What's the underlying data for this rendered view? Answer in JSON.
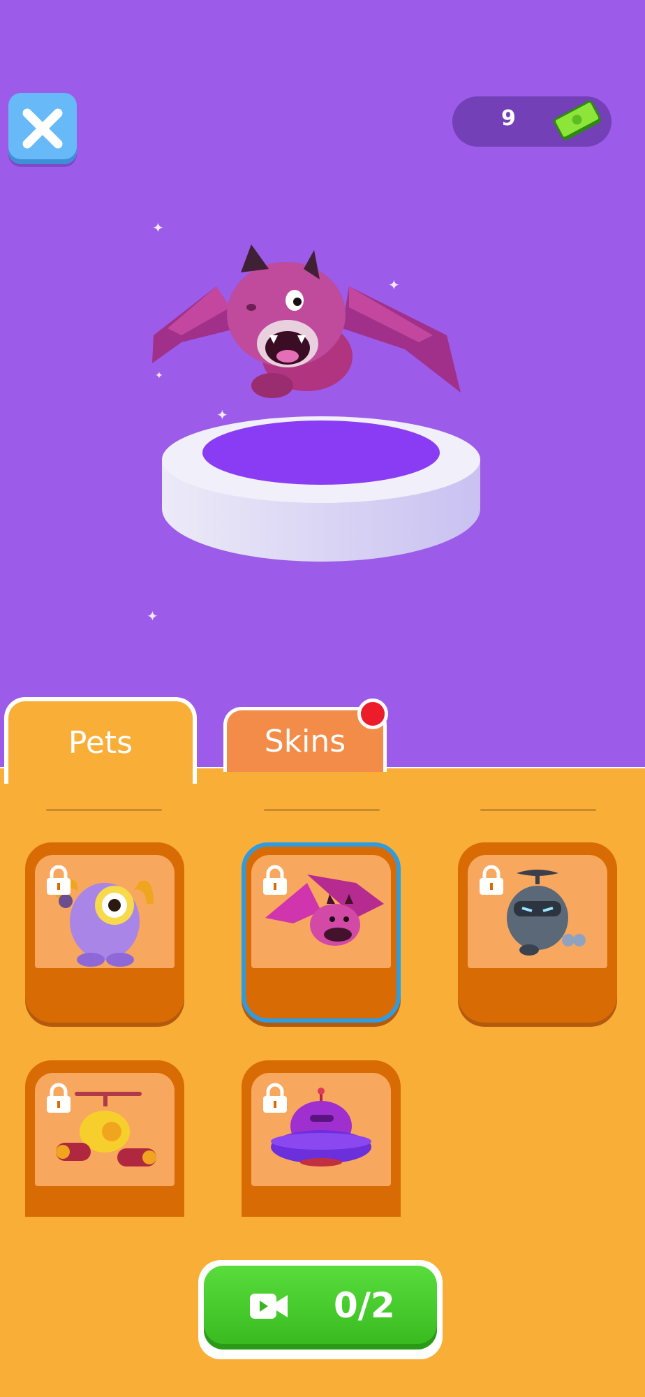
{
  "header": {
    "close_icon": "close-icon",
    "currency": {
      "value": "9",
      "icon": "cash-icon"
    }
  },
  "preview": {
    "pet": "purple-dragon",
    "pedestal_color": "#8a3cf4"
  },
  "tabs": [
    {
      "label": "Pets",
      "active": true
    },
    {
      "label": "Skins",
      "active": false,
      "notification": true
    }
  ],
  "pets": [
    {
      "name": "purple-cyclops",
      "locked": true,
      "selected": false
    },
    {
      "name": "purple-dragon",
      "locked": true,
      "selected": true
    },
    {
      "name": "helicopter-robot",
      "locked": true,
      "selected": false
    },
    {
      "name": "yellow-drone",
      "locked": true,
      "selected": false
    },
    {
      "name": "purple-ufo",
      "locked": true,
      "selected": false
    }
  ],
  "ad_button": {
    "icon": "video-camera-icon",
    "count": "0/2"
  },
  "colors": {
    "background": "#9c5be9",
    "panel": "#f9ae37",
    "card": "#d96b05",
    "selected_border": "#2f9be0",
    "ad_button": "#46c62a"
  }
}
